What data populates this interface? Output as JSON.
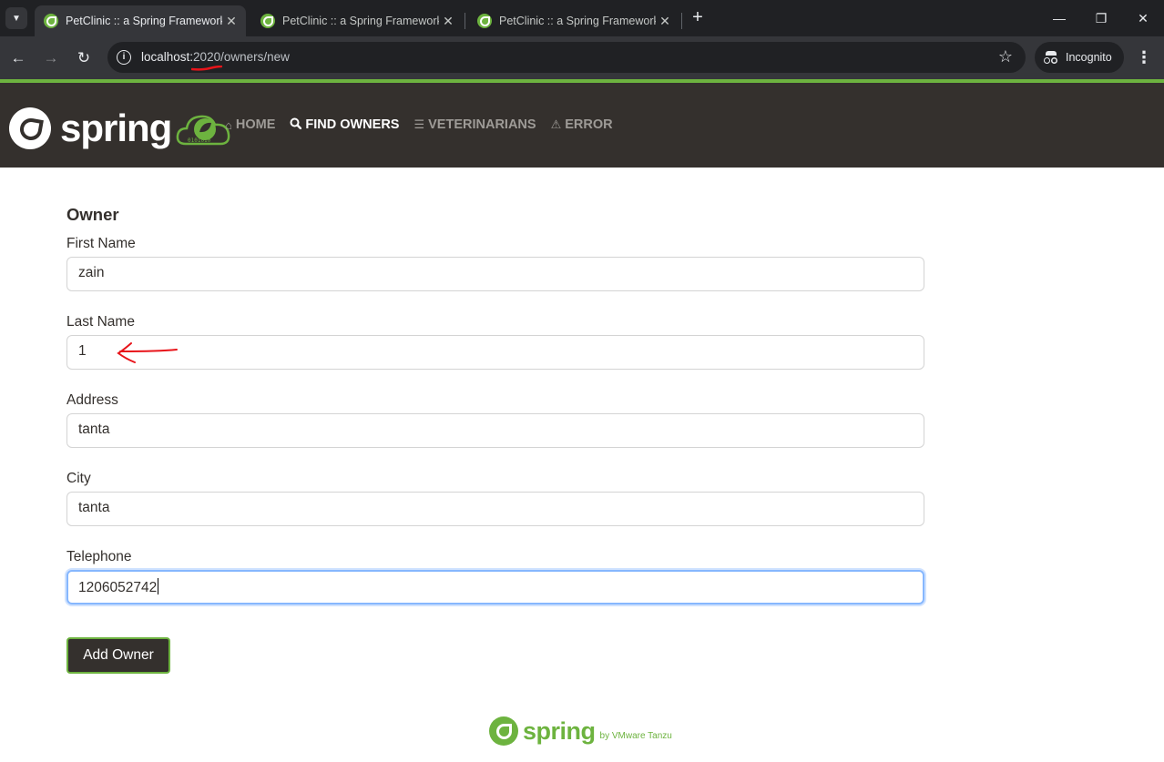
{
  "browser": {
    "tabs": [
      {
        "title": "PetClinic :: a Spring Framework",
        "active": true
      },
      {
        "title": "PetClinic :: a Spring Framework",
        "active": false
      },
      {
        "title": "PetClinic :: a Spring Framework",
        "active": false
      }
    ],
    "url_host": "localhost:",
    "url_port": "2020",
    "url_path": "/owners/new",
    "incognito_label": "Incognito"
  },
  "site": {
    "logo_text": "spring",
    "nav": [
      {
        "label": "HOME",
        "icon": "home-icon",
        "active": false
      },
      {
        "label": "FIND OWNERS",
        "icon": "search-icon",
        "active": true
      },
      {
        "label": "VETERINARIANS",
        "icon": "list-icon",
        "active": false
      },
      {
        "label": "ERROR",
        "icon": "warning-icon",
        "active": false
      }
    ]
  },
  "form": {
    "title": "Owner",
    "fields": [
      {
        "label": "First Name",
        "value": "zain"
      },
      {
        "label": "Last Name",
        "value": "1"
      },
      {
        "label": "Address",
        "value": "tanta"
      },
      {
        "label": "City",
        "value": "tanta"
      },
      {
        "label": "Telephone",
        "value": "1206052742"
      }
    ],
    "submit_label": "Add Owner"
  },
  "footer": {
    "logo_text": "spring",
    "byline": "by VMware Tanzu"
  },
  "colors": {
    "spring_green": "#6db33f",
    "navbar_dark": "#34302d",
    "chrome_dark": "#202124",
    "annotation_red": "#e8141a"
  }
}
